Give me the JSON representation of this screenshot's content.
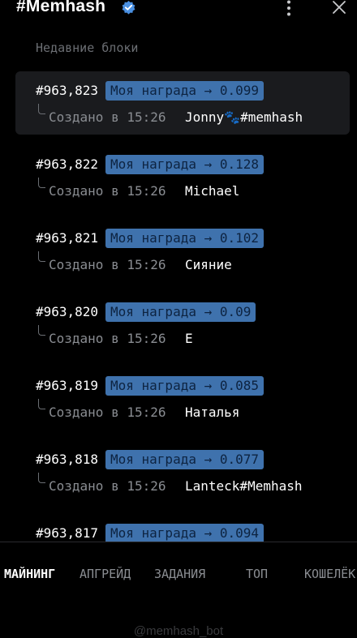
{
  "header": {
    "title": "#Memhash",
    "verified_icon": "verified-badge-icon",
    "menu_icon": "more-vertical-icon",
    "close_icon": "close-icon"
  },
  "section": {
    "title": "Недавние блоки"
  },
  "blocks": [
    {
      "number": "#963,823",
      "reward": "Моя награда → 0.099",
      "created": "Создано в 15:26",
      "miner": "Jonny🐾#memhash",
      "active": true
    },
    {
      "number": "#963,822",
      "reward": "Моя награда → 0.128",
      "created": "Создано в 15:26",
      "miner": "Michael",
      "active": false
    },
    {
      "number": "#963,821",
      "reward": "Моя награда → 0.102",
      "created": "Создано в 15:26",
      "miner": "Сияние",
      "active": false
    },
    {
      "number": "#963,820",
      "reward": "Моя награда → 0.09",
      "created": "Создано в 15:26",
      "miner": "E",
      "active": false
    },
    {
      "number": "#963,819",
      "reward": "Моя награда → 0.085",
      "created": "Создано в 15:26",
      "miner": "Наталья",
      "active": false
    },
    {
      "number": "#963,818",
      "reward": "Моя награда → 0.077",
      "created": "Создано в 15:26",
      "miner": "Lanteck#Memhash",
      "active": false
    },
    {
      "number": "#963,817",
      "reward": "Моя награда → 0.094",
      "created": "",
      "miner": "",
      "active": false
    }
  ],
  "nav": {
    "items": [
      {
        "label": "МАЙНИНГ",
        "active": true
      },
      {
        "label": "АПГРЕЙД",
        "active": false
      },
      {
        "label": "ЗАДАНИЯ",
        "active": false
      },
      {
        "label": "ТОП",
        "active": false
      },
      {
        "label": "КОШЕЛЁК",
        "active": false
      }
    ]
  },
  "footer": {
    "text": "@memhash_bot"
  },
  "colors": {
    "background": "#000000",
    "reward_badge": "#3f72ad",
    "active_block_bg": "#1a1b1e",
    "muted_text": "#8a8d92"
  }
}
